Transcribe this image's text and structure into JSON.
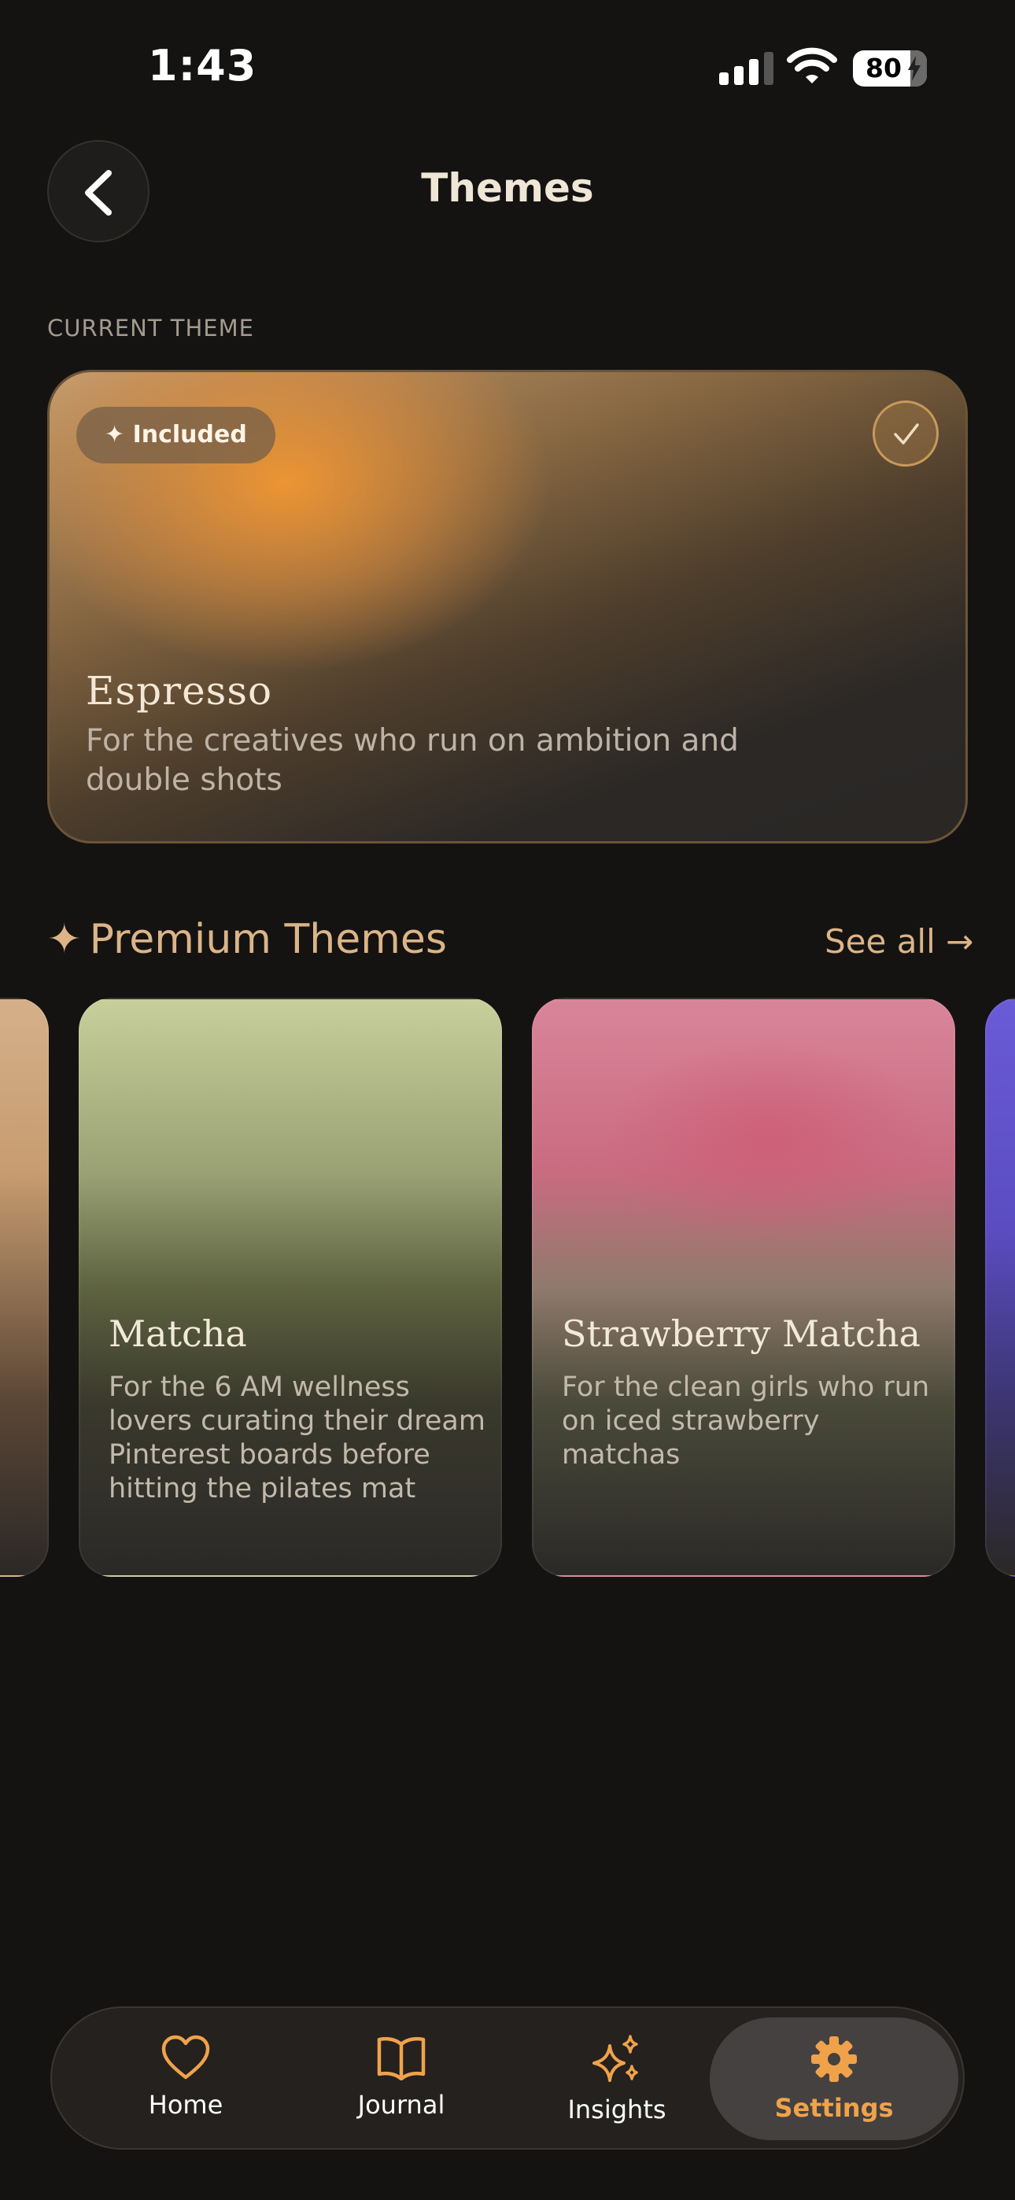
{
  "status": {
    "time": "1:43",
    "battery": "80"
  },
  "header": {
    "title": "Themes"
  },
  "current": {
    "section_label": "CURRENT THEME",
    "badge": "✦ Included",
    "name": "Espresso",
    "description": "For the creatives who run on ambition and double shots"
  },
  "premium": {
    "title": "Premium Themes",
    "see_all": "See all →",
    "cards": [
      {
        "name": "Matcha",
        "description": "For the 6 AM wellness lovers curating their dream Pinterest boards before hitting the pilates mat"
      },
      {
        "name": "Strawberry Matcha",
        "description": "For the clean girls who run on iced strawberry matchas"
      }
    ]
  },
  "tabs": [
    {
      "label": "Home",
      "icon": "heart-icon"
    },
    {
      "label": "Journal",
      "icon": "book-icon"
    },
    {
      "label": "Insights",
      "icon": "sparkles-icon"
    },
    {
      "label": "Settings",
      "icon": "gear-icon",
      "active": true
    }
  ],
  "colors": {
    "accent": "#F0A24A",
    "gold": "#DCB487",
    "background": "#141312"
  }
}
